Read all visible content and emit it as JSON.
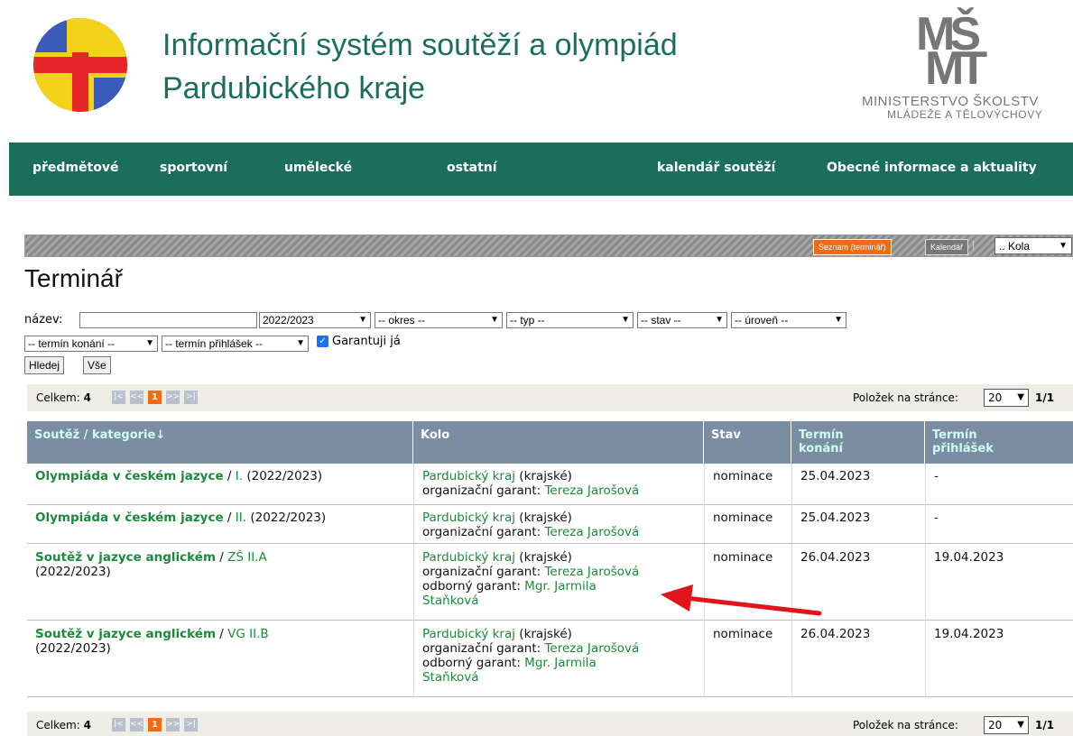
{
  "header": {
    "title_line1": "Informační systém soutěží a olympiád",
    "title_line2": "Pardubického kraje",
    "ministry_mark_top": "MŠ",
    "ministry_mark_bottom": "MT",
    "ministry_line1": "MINISTERSTVO ŠKOLSTV",
    "ministry_line2": "MLÁDEŽE A TĚLOVÝCHOVY"
  },
  "nav": {
    "items": [
      "předmětové",
      "sportovní",
      "umělecké",
      "ostatní",
      "kalendář soutěží",
      "Obecné informace a aktuality"
    ]
  },
  "view": {
    "list_button": "Seznam (terminář)",
    "calendar_button": "Kalendář",
    "separator": "|",
    "round_select": ".. Kola"
  },
  "page_title": "Terminář",
  "filter": {
    "name_label": "název:",
    "name_value": "",
    "year": "2022/2023",
    "district": "-- okres --",
    "type": "-- typ --",
    "state": "-- stav --",
    "level": "-- úroveň --",
    "event_date": "-- termín konání --",
    "registration_date": "-- termín přihlášek --",
    "guarantee_checked": true,
    "guarantee_label": "Garantuji já",
    "search_button": "Hledej",
    "all_button": "Vše"
  },
  "pager": {
    "total_label": "Celkem:",
    "total": "4",
    "first": "|<",
    "prev": "<<",
    "current_page": "1",
    "next": ">>",
    "last": ">|",
    "per_page_label": "Položek na stránce:",
    "per_page": "20",
    "pages": "1/1"
  },
  "table": {
    "columns": {
      "competition": "Soutěž / kategorie↓",
      "round": "Kolo",
      "state": "Stav",
      "event_date_1": "Termín",
      "event_date_2": "konání",
      "reg_date_1": "Termín",
      "reg_date_2": "přihlášek"
    },
    "rows": [
      {
        "competition": "Olympiáda v českém jazyce",
        "category": "I.",
        "year": "(2022/2023)",
        "region": "Pardubický kraj",
        "level": "(krajské)",
        "org_label": "organizační garant:",
        "org_name": "Tereza Jarošová",
        "expert_label": "",
        "expert_name_1": "",
        "expert_name_2": "",
        "state": "nominace",
        "event_date": "25.04.2023",
        "reg_date": "-"
      },
      {
        "competition": "Olympiáda v českém jazyce",
        "category": "II.",
        "year": "(2022/2023)",
        "region": "Pardubický kraj",
        "level": "(krajské)",
        "org_label": "organizační garant:",
        "org_name": "Tereza Jarošová",
        "expert_label": "",
        "expert_name_1": "",
        "expert_name_2": "",
        "state": "nominace",
        "event_date": "25.04.2023",
        "reg_date": "-"
      },
      {
        "competition": "Soutěž v jazyce anglickém",
        "category": "ZŠ II.A",
        "year": "(2022/2023)",
        "region": "Pardubický kraj",
        "level": "(krajské)",
        "org_label": "organizační garant:",
        "org_name": "Tereza Jarošová",
        "expert_label": "odborný garant:",
        "expert_name_1": "Mgr. Jarmila",
        "expert_name_2": "Staňková",
        "state": "nominace",
        "event_date": "26.04.2023",
        "reg_date": "19.04.2023"
      },
      {
        "competition": "Soutěž v jazyce anglickém",
        "category": "VG II.B",
        "year": "(2022/2023)",
        "region": "Pardubický kraj",
        "level": "(krajské)",
        "org_label": "organizační garant:",
        "org_name": "Tereza Jarošová",
        "expert_label": "odborný garant:",
        "expert_name_1": "Mgr. Jarmila",
        "expert_name_2": "Staňková",
        "state": "nominace",
        "event_date": "26.04.2023",
        "reg_date": "19.04.2023"
      }
    ]
  },
  "colors": {
    "brand_green": "#1c6e5c",
    "link_green": "#1c8a3a",
    "table_header": "#7a8da2",
    "accent_orange": "#f26b10",
    "annotation_arrow": "#e0141a"
  }
}
